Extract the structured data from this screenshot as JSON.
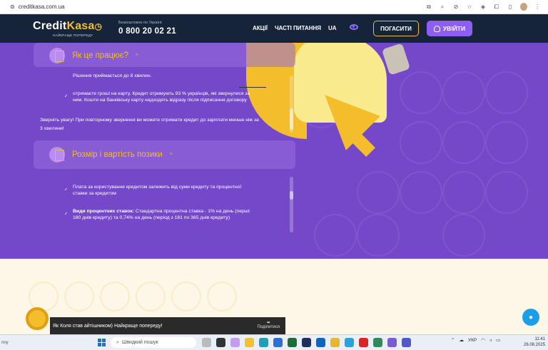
{
  "browser": {
    "url": "creditkasa.com.ua"
  },
  "header": {
    "logo_main": "Credit",
    "logo_accent": "Kasa",
    "logo_tagline": "НАЙКРАЩЕ ПОПЕРЕДУ",
    "phone_caption": "Безкоштовно по Україні:",
    "phone_number": "0 800 20 02 21",
    "nav": [
      "АКЦІЇ",
      "ЧАСТІ ПИТАННЯ",
      "UA"
    ],
    "pay_button": "ПОГАСИТИ",
    "login_button": "УВІЙТИ"
  },
  "panels": [
    {
      "title": "Як це працює?",
      "items": [
        "Рішення приймається до 8 хвилин.",
        "отримаєте гроші на карту. Кредит отримують 93 % українців, які звернулися за ним. Кошти на банківську карту надходять відразу після підписання договору"
      ],
      "note": "Зверніть увагу! При повторному зверненні ви можете отримати кредит до зарплати менше ніж за 3 хвилини!"
    },
    {
      "title": "Розмір і вартість позики",
      "items": [
        "Плата за користування кредитом залежить від суми кредиту та процентної ставки за кредитом"
      ],
      "rates_label": "Види процентних ставок:",
      "rates_text": "Стандартна процентна ставка - 1% на день (перші 180 днів кредиту) та 0,74% на день (період з 181 по 365 днів кредиту)"
    }
  ],
  "video": {
    "title": "Як Коля став айтішником) Найкраще попереду!",
    "share_label": "Поділитися"
  },
  "taskbar": {
    "left_text": "nny",
    "search_placeholder": "Швидкий пошук",
    "lang": "УКР",
    "time": "11:41",
    "date": "26.08.2025"
  },
  "colors": {
    "header_bg": "#16243a",
    "purple": "#7547c9",
    "accent": "#f4bd2b",
    "login_bg": "#8e5ef2"
  }
}
